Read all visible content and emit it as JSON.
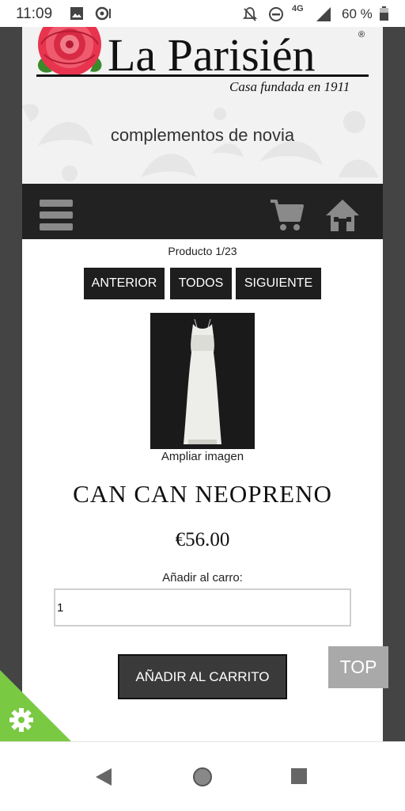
{
  "status_bar": {
    "time": "11:09",
    "network": "4G",
    "battery": "60 %",
    "icons": [
      "image-icon",
      "sync-icon",
      "notifications-off-icon",
      "do-not-disturb-icon",
      "signal-icon",
      "battery-icon"
    ]
  },
  "header": {
    "brand_name": "La Parisién",
    "brand_tagline": "Casa fundada en 1911",
    "subtitle": "complementos de novia"
  },
  "navbar": {
    "icons": [
      "menu-icon",
      "cart-icon",
      "home-icon"
    ]
  },
  "product": {
    "counter": "Producto 1/23",
    "prev_label": "ANTERIOR",
    "all_label": "TODOS",
    "next_label": "SIGUIENTE",
    "zoom_label": "Ampliar imagen",
    "title": "CAN CAN NEOPRENO",
    "price": "€56.00",
    "qty_label": "Añadir al carro:",
    "qty_value": "1",
    "add_button": "AÑADIR AL CARRITO"
  },
  "top_button": "TOP",
  "colors": {
    "navbar": "#222222",
    "gutter": "#444444",
    "cookie": "#7ac943",
    "button_dark": "#1e1e1e",
    "rose": "#e8344e"
  },
  "android_nav": {
    "icons": [
      "back-icon",
      "home-circle-icon",
      "recents-icon"
    ]
  }
}
